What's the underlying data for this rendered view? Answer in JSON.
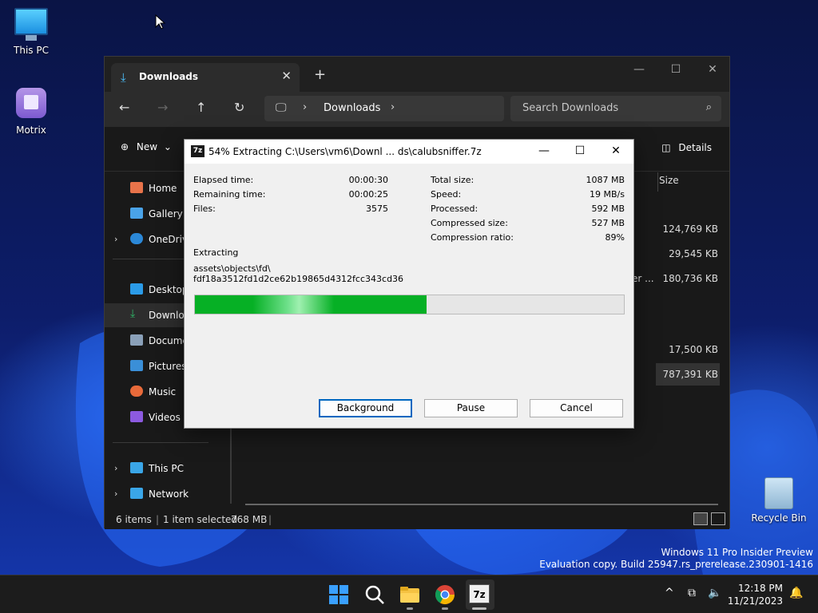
{
  "desktop": {
    "icons": [
      {
        "label": "This PC",
        "icon": "monitor-icon"
      },
      {
        "label": "Motrix",
        "icon": "motrix-app-icon"
      },
      {
        "label": "Recycle Bin",
        "icon": "recycle-bin-icon"
      }
    ],
    "watermark": {
      "line1": "Windows 11 Pro Insider Preview",
      "line2": "Evaluation copy. Build 25947.rs_prerelease.230901-1416"
    }
  },
  "explorer": {
    "tab_title": "Downloads",
    "new_tab": "+",
    "close_tab": "✕",
    "window_controls": {
      "minimize": "—",
      "maximize": "☐",
      "close": "✕"
    },
    "breadcrumb": "Downloads",
    "search_placeholder": "Search Downloads",
    "toolbar": {
      "new_label": "New",
      "details_label": "Details"
    },
    "sidebar": [
      {
        "label": "Home",
        "icon": "home-icon",
        "color": "#e8734a"
      },
      {
        "label": "Gallery",
        "icon": "gallery-icon",
        "color": "#4aa3e8"
      },
      {
        "label": "OneDrive",
        "icon": "onedrive-icon",
        "color": "#2b88d8"
      },
      {
        "label": "Desktop",
        "icon": "desktop-folder-icon",
        "color": "#2b9be8"
      },
      {
        "label": "Downloads",
        "icon": "download-icon",
        "color": "#2fb567"
      },
      {
        "label": "Documents",
        "icon": "documents-icon",
        "color": "#8aa0b8"
      },
      {
        "label": "Pictures",
        "icon": "pictures-icon",
        "color": "#3a8fd8"
      },
      {
        "label": "Music",
        "icon": "music-icon",
        "color": "#e86a3a"
      },
      {
        "label": "Videos",
        "icon": "videos-icon",
        "color": "#8c5ae0"
      },
      {
        "label": "This PC",
        "icon": "this-pc-icon",
        "color": "#3aa6e8"
      },
      {
        "label": "Network",
        "icon": "network-icon",
        "color": "#3aa6e8"
      }
    ],
    "column_header": "Size",
    "rows": [
      {
        "size": "124,769 KB"
      },
      {
        "size": "29,545 KB"
      },
      {
        "size": "180,736 KB",
        "name_fragment": "er ..."
      },
      {
        "size": "17,500 KB"
      },
      {
        "size": "787,391 KB"
      }
    ],
    "status": {
      "items": "6 items",
      "selected": "1 item selected",
      "size": "768 MB"
    }
  },
  "dialog": {
    "title": "54% Extracting C:\\Users\\vm6\\Downl ... ds\\calubsniffer.7z",
    "logo": "7z",
    "window_controls": {
      "minimize": "—",
      "maximize": "☐",
      "close": "✕"
    },
    "left_stats": [
      {
        "label": "Elapsed time:",
        "value": "00:00:30"
      },
      {
        "label": "Remaining time:",
        "value": "00:00:25"
      },
      {
        "label": "Files:",
        "value": "3575"
      }
    ],
    "right_stats": [
      {
        "label": "Total size:",
        "value": "1087 MB"
      },
      {
        "label": "Speed:",
        "value": "19 MB/s"
      },
      {
        "label": "Processed:",
        "value": "592 MB"
      },
      {
        "label": "Compressed size:",
        "value": "527 MB"
      },
      {
        "label": "Compression ratio:",
        "value": "89%"
      }
    ],
    "operation": "Extracting",
    "current_path_line1": "assets\\objects\\fd\\",
    "current_path_line2": "fdf18a3512fd1d2ce62b19865d4312fcc343cd36",
    "progress_fraction": 0.54,
    "buttons": {
      "background": "Background",
      "pause": "Pause",
      "cancel": "Cancel"
    }
  },
  "taskbar": {
    "apps": [
      {
        "name": "start-button-icon"
      },
      {
        "name": "search-icon"
      },
      {
        "name": "file-explorer-icon"
      },
      {
        "name": "chrome-icon"
      },
      {
        "name": "7zip-icon",
        "label": "7z"
      }
    ],
    "tray": {
      "chevron": "^"
    },
    "clock": {
      "time": "12:18 PM",
      "date": "11/21/2023"
    }
  }
}
